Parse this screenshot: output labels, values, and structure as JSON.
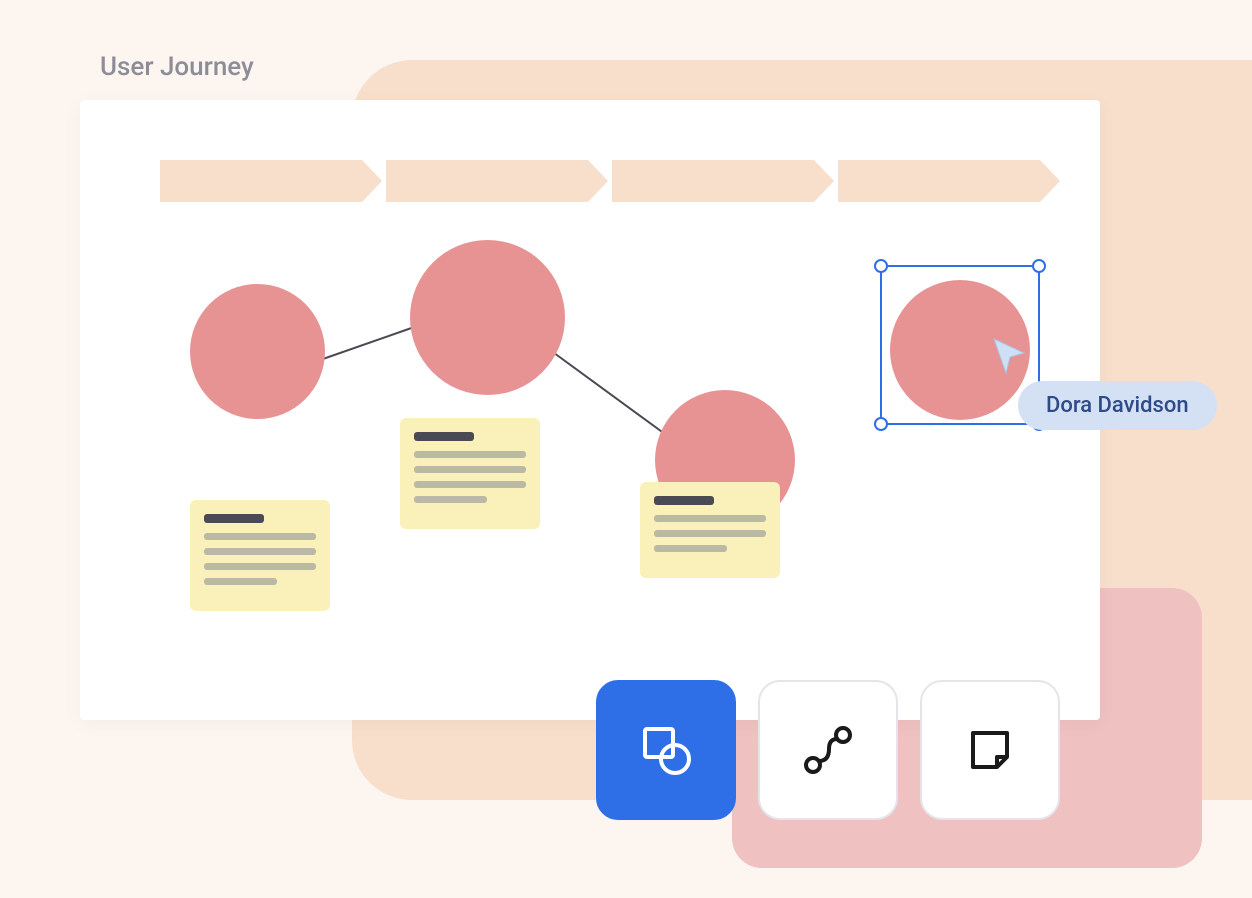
{
  "title": "User Journey",
  "collaborator": {
    "name": "Dora Davidson"
  },
  "stages": {
    "count": 4
  },
  "nodes": [
    {
      "id": "node-1"
    },
    {
      "id": "node-2"
    },
    {
      "id": "node-3"
    },
    {
      "id": "node-4",
      "selected": true
    }
  ],
  "notes": [
    {
      "id": "note-1"
    },
    {
      "id": "note-2"
    },
    {
      "id": "note-3"
    }
  ],
  "toolbar": {
    "shape": {
      "label": "Shape",
      "active": true
    },
    "connector": {
      "label": "Connector",
      "active": false
    },
    "sticky": {
      "label": "Sticky note",
      "active": false
    }
  },
  "colors": {
    "accent": "#2E6FE8",
    "node": "#E89393",
    "note": "#F9F1B9",
    "stage": "#F7DFCB",
    "bg": "#FDF5F0"
  }
}
